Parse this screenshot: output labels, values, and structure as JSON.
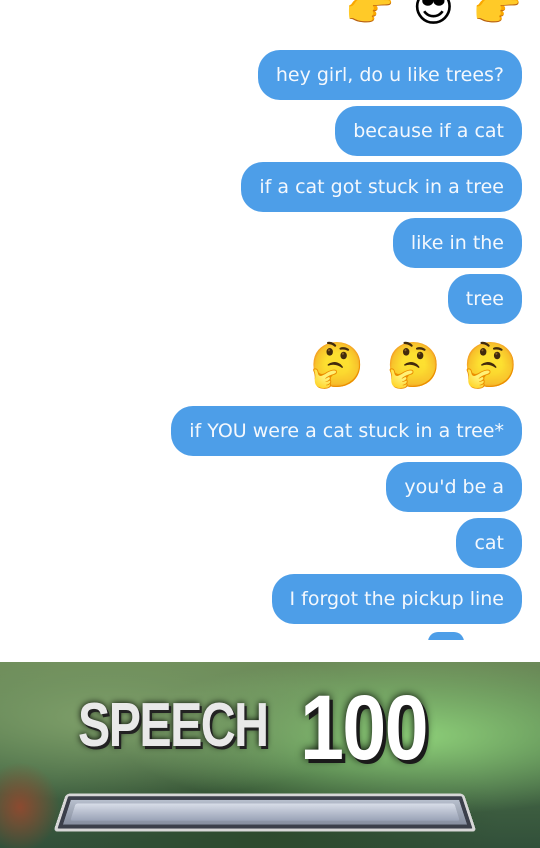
{
  "chat": {
    "top_emojis": [
      "👉",
      "😎",
      "👉"
    ],
    "messages": [
      {
        "text": "hey girl, do u like trees?"
      },
      {
        "text": "because if a cat"
      },
      {
        "text": "if a cat got stuck in a tree"
      },
      {
        "text": "like in the"
      },
      {
        "text": "tree"
      },
      {
        "text": "if YOU were a cat stuck in a tree*"
      },
      {
        "text": "you'd be a"
      },
      {
        "text": "cat"
      },
      {
        "text": "I forgot the pickup line"
      }
    ],
    "thinking_emojis": [
      "🤔",
      "🤔",
      "🤔"
    ],
    "bubble_color": "#4d9ee8"
  },
  "banner": {
    "skill_name": "SPEECH",
    "skill_level": "100",
    "skill_bar_fill": 1.0
  }
}
